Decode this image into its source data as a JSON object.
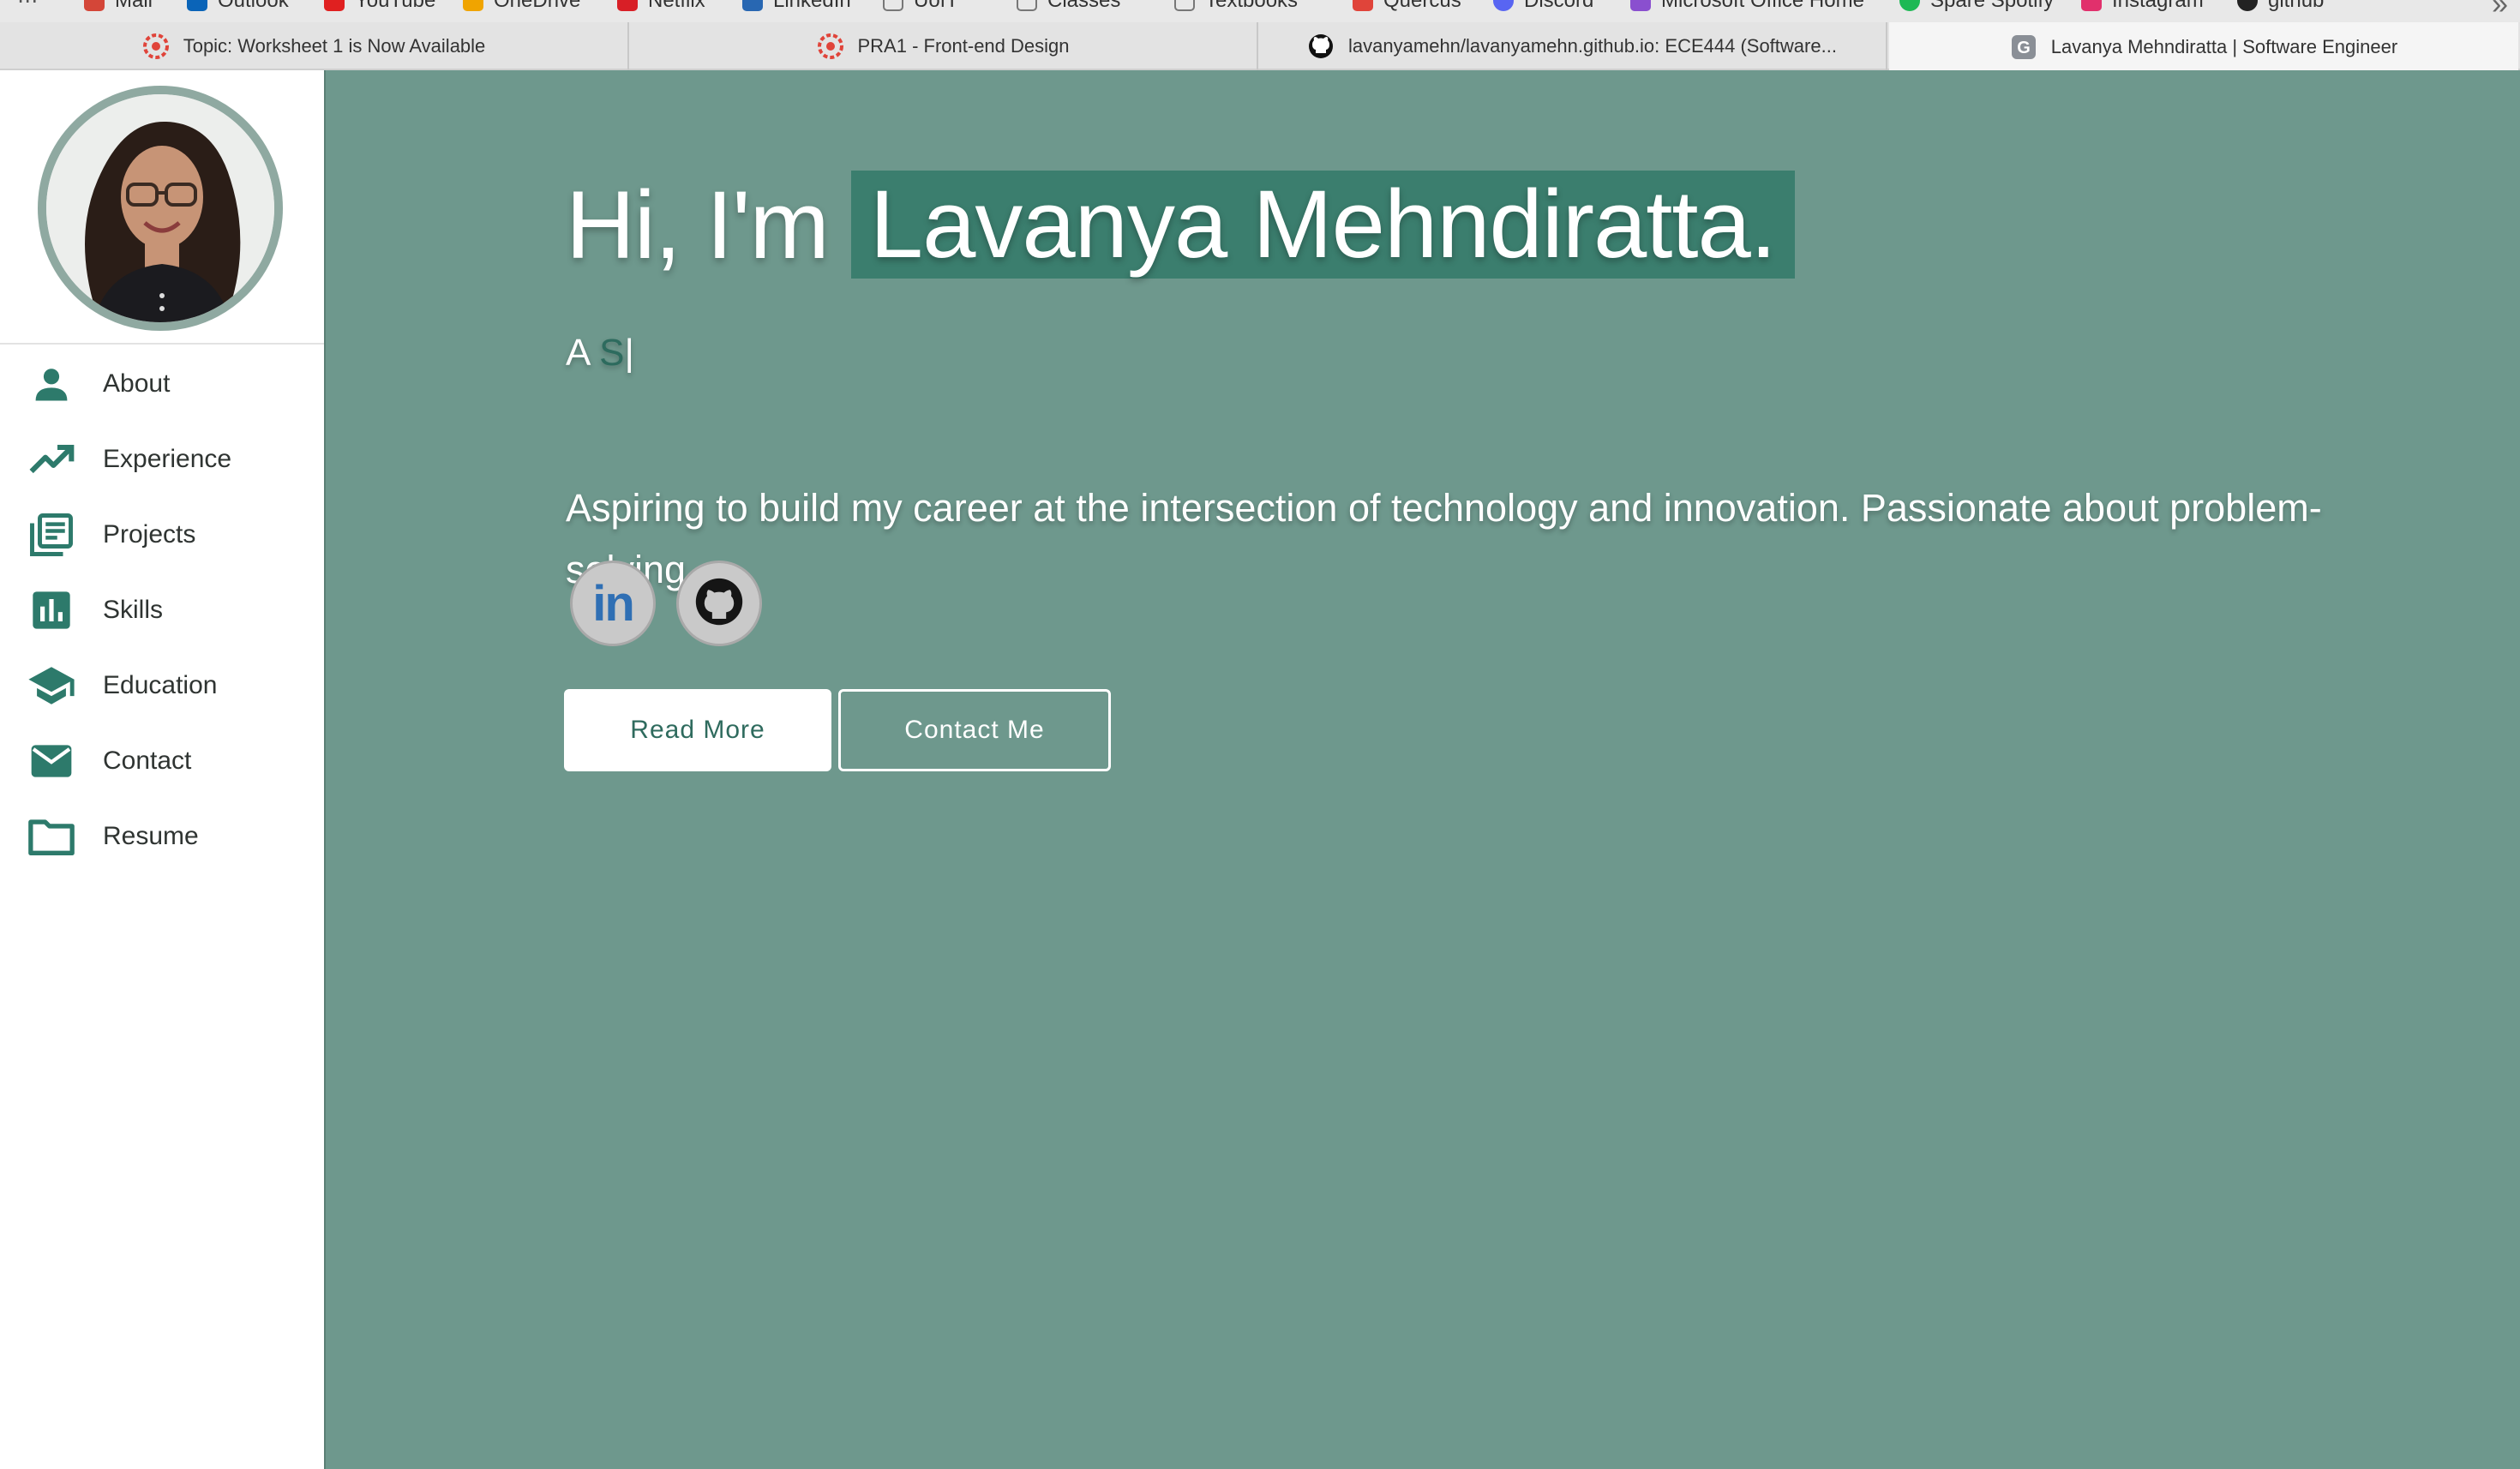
{
  "colors": {
    "accent": "#3b7e6e",
    "main_bg": "#6e988d",
    "sidebar_bg": "#ffffff",
    "icon_color": "#2d7a6b"
  },
  "bookmarks": [
    {
      "label": "Mail",
      "icon": "gmail-icon",
      "color": "#d44638"
    },
    {
      "label": "Outlook",
      "icon": "outlook-icon",
      "color": "#0a64b8"
    },
    {
      "label": "YouTube",
      "icon": "youtube-icon",
      "color": "#e02020"
    },
    {
      "label": "OneDrive",
      "icon": "onedrive-icon",
      "color": "#f0a400"
    },
    {
      "label": "Netflix",
      "icon": "netflix-icon",
      "color": "#d81f26"
    },
    {
      "label": "LinkedIn",
      "icon": "linkedin-icon",
      "color": "#2867b2"
    },
    {
      "label": "UofT",
      "icon": "folder-icon",
      "color": "#888888"
    },
    {
      "label": "Classes",
      "icon": "folder-icon",
      "color": "#888888"
    },
    {
      "label": "Textbooks",
      "icon": "folder-icon",
      "color": "#888888"
    },
    {
      "label": "Quercus",
      "icon": "quercus-icon",
      "color": "#e0443a"
    },
    {
      "label": "Discord",
      "icon": "discord-icon",
      "color": "#5865f2"
    },
    {
      "label": "Microsoft Office Home",
      "icon": "office-icon",
      "color": "#8a4fcf"
    },
    {
      "label": "Spare Spotify",
      "icon": "spotify-icon",
      "color": "#1db954"
    },
    {
      "label": "Instagram",
      "icon": "instagram-icon",
      "color": "#e1306c"
    },
    {
      "label": "github",
      "icon": "github-icon",
      "color": "#222222"
    }
  ],
  "tabs": [
    {
      "label": "Topic: Worksheet 1 is Now Available",
      "icon": "quercus-icon",
      "active": false
    },
    {
      "label": "PRA1 - Front-end Design",
      "icon": "quercus-icon",
      "active": false
    },
    {
      "label": "lavanyamehn/lavanyamehn.github.io: ECE444 (Software...",
      "icon": "github-icon",
      "active": false
    },
    {
      "label": "Lavanya Mehndiratta | Software Engineer",
      "icon": "google-g-icon",
      "active": true
    }
  ],
  "sidebar": {
    "items": [
      {
        "label": "About",
        "icon": "person-icon"
      },
      {
        "label": "Experience",
        "icon": "trending-up-icon"
      },
      {
        "label": "Projects",
        "icon": "library-books-icon"
      },
      {
        "label": "Skills",
        "icon": "bar-chart-icon"
      },
      {
        "label": "Education",
        "icon": "school-icon"
      },
      {
        "label": "Contact",
        "icon": "mail-icon"
      },
      {
        "label": "Resume",
        "icon": "folder-icon"
      }
    ]
  },
  "hero": {
    "greeting": "Hi, I'm",
    "name": "Lavanya Mehndiratta.",
    "typed_prefix": "A",
    "typed_text": "S",
    "typed_cursor": "|",
    "description": "Aspiring to build my career at the intersection of technology and innovation. Passionate about problem-solving.",
    "socials": [
      {
        "label": "in",
        "icon": "linkedin-icon"
      },
      {
        "label": "",
        "icon": "github-icon"
      }
    ],
    "read_more_label": "Read More",
    "contact_label": "Contact Me"
  }
}
